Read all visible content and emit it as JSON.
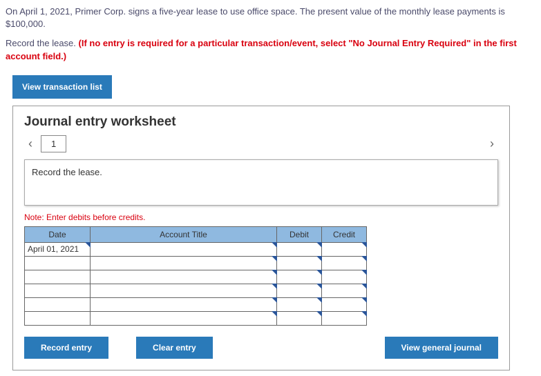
{
  "prompt": {
    "line1": "On April 1, 2021, Primer Corp. signs a five-year lease to use office space. The present value of the monthly lease payments is $100,000.",
    "line2a": "Record the lease. ",
    "line2b": "(If no entry is required for a particular transaction/event, select \"No Journal Entry Required\" in the first account field.)"
  },
  "buttons": {
    "view_list": "View transaction list",
    "record": "Record entry",
    "clear": "Clear entry",
    "view_journal": "View general journal"
  },
  "worksheet": {
    "title": "Journal entry worksheet",
    "tab": "1",
    "instruction": "Record the lease.",
    "note": "Note: Enter debits before credits.",
    "headers": {
      "date": "Date",
      "account": "Account Title",
      "debit": "Debit",
      "credit": "Credit"
    },
    "first_date": "April 01, 2021"
  }
}
